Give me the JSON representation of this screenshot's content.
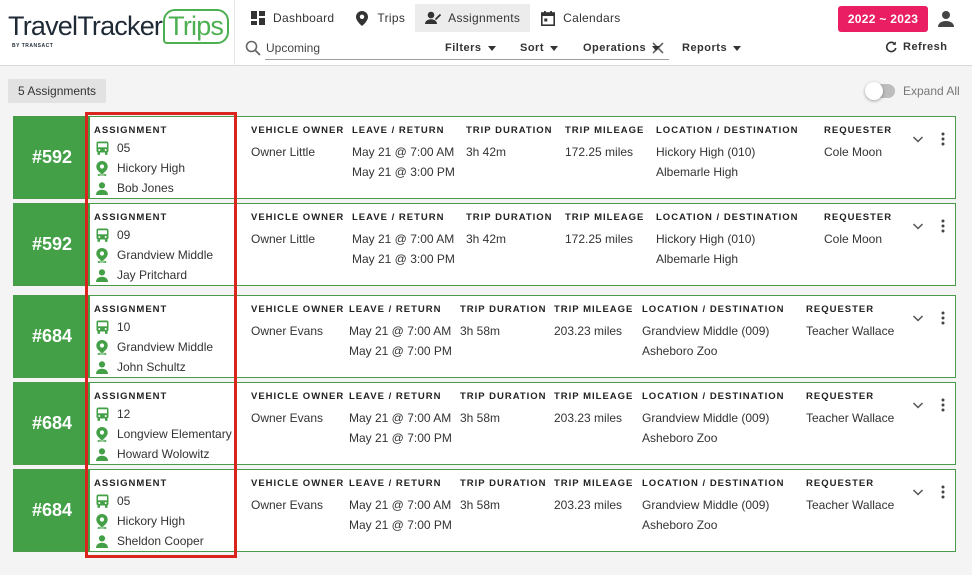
{
  "brand": {
    "name_part1": "TravelTracker",
    "name_part2": "Trips",
    "byline": "BY TRANSACT"
  },
  "nav": {
    "tabs": [
      {
        "label": "Dashboard",
        "icon": "dashboard-icon"
      },
      {
        "label": "Trips",
        "icon": "location-pin-icon"
      },
      {
        "label": "Assignments",
        "icon": "person-assign-icon",
        "active": true
      },
      {
        "label": "Calendars",
        "icon": "calendar-icon"
      }
    ],
    "year_range": "2022 ~ 2023"
  },
  "toolbar": {
    "search_value": "Upcoming",
    "filters_label": "Filters",
    "sort_label": "Sort",
    "operations_label": "Operations",
    "reports_label": "Reports",
    "refresh_label": "Refresh"
  },
  "summary": {
    "count_label": "5 Assignments",
    "expand_all_label": "Expand All"
  },
  "columns": {
    "assignment": "ASSIGNMENT",
    "vehicle_owner": "VEHICLE OWNER",
    "leave_return": "LEAVE / RETURN",
    "trip_duration": "TRIP DURATION",
    "trip_mileage": "TRIP MILEAGE",
    "location_destination": "LOCATION / DESTINATION",
    "requester": "REQUESTER"
  },
  "assignments": [
    {
      "number": "#592",
      "bus": "05",
      "school": "Hickory High",
      "driver": "Bob Jones",
      "owner": "Owner Little",
      "leave": "May 21 @ 7:00 AM",
      "return": "May 21 @ 3:00 PM",
      "duration": "3h 42m",
      "mileage": "172.25 miles",
      "location": "Hickory High (010)",
      "destination": "Albemarle High",
      "requester": "Cole Moon"
    },
    {
      "number": "#592",
      "bus": "09",
      "school": "Grandview Middle",
      "driver": "Jay Pritchard",
      "owner": "Owner Little",
      "leave": "May 21 @ 7:00 AM",
      "return": "May 21 @ 3:00 PM",
      "duration": "3h 42m",
      "mileage": "172.25 miles",
      "location": "Hickory High (010)",
      "destination": "Albemarle High",
      "requester": "Cole Moon"
    },
    {
      "number": "#684",
      "bus": "10",
      "school": "Grandview Middle",
      "driver": "John Schultz",
      "owner": "Owner Evans",
      "leave": "May 21 @ 7:00 AM",
      "return": "May 21 @ 7:00 PM",
      "duration": "3h 58m",
      "mileage": "203.23 miles",
      "location": "Grandview Middle (009)",
      "destination": "Asheboro Zoo",
      "requester": "Teacher Wallace"
    },
    {
      "number": "#684",
      "bus": "12",
      "school": "Longview Elementary",
      "driver": "Howard Wolowitz",
      "owner": "Owner Evans",
      "leave": "May 21 @ 7:00 AM",
      "return": "May 21 @ 7:00 PM",
      "duration": "3h 58m",
      "mileage": "203.23 miles",
      "location": "Grandview Middle (009)",
      "destination": "Asheboro Zoo",
      "requester": "Teacher Wallace"
    },
    {
      "number": "#684",
      "bus": "05",
      "school": "Hickory High",
      "driver": "Sheldon Cooper",
      "owner": "Owner Evans",
      "leave": "May 21 @ 7:00 AM",
      "return": "May 21 @ 7:00 PM",
      "duration": "3h 58m",
      "mileage": "203.23 miles",
      "location": "Grandview Middle (009)",
      "destination": "Asheboro Zoo",
      "requester": "Teacher Wallace"
    }
  ],
  "colors": {
    "accent_green": "#43a047",
    "year_pink": "#e91e63",
    "highlight_red": "#d9251d"
  }
}
